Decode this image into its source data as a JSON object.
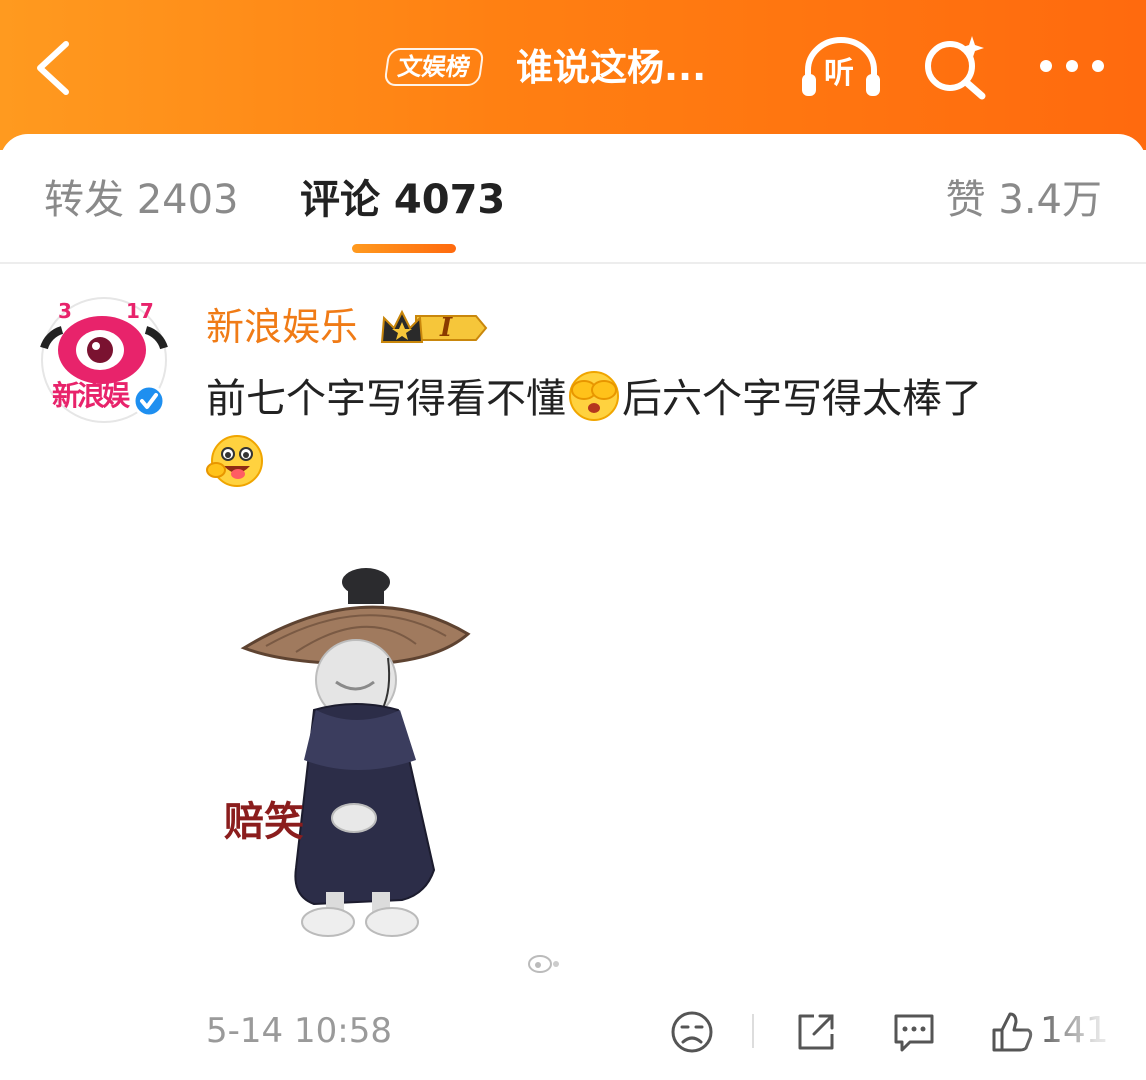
{
  "header": {
    "tag": "文娱榜",
    "title": "谁说这杨...",
    "listen_label": "听",
    "icons": [
      "back-arrow-icon",
      "headphones-icon",
      "search-sparkle-icon",
      "more-dots-icon"
    ]
  },
  "tabs": {
    "repost": "转发 2403",
    "comment": "评论 4073",
    "like": "赞 3.4万"
  },
  "comment": {
    "username": "新浪娱乐",
    "avatar_text": "新浪娱",
    "vip_level": "I",
    "text_part1": "前七个字写得看不懂",
    "text_part2": "后六个字写得太棒了",
    "sticker_caption": "赔笑",
    "timestamp": "5-14 10:58",
    "like_count": "141"
  },
  "colors": {
    "header_start": "#ff9a1f",
    "header_end": "#ff6a0e",
    "username": "#f07b16",
    "verified": "#1e8ff0"
  }
}
